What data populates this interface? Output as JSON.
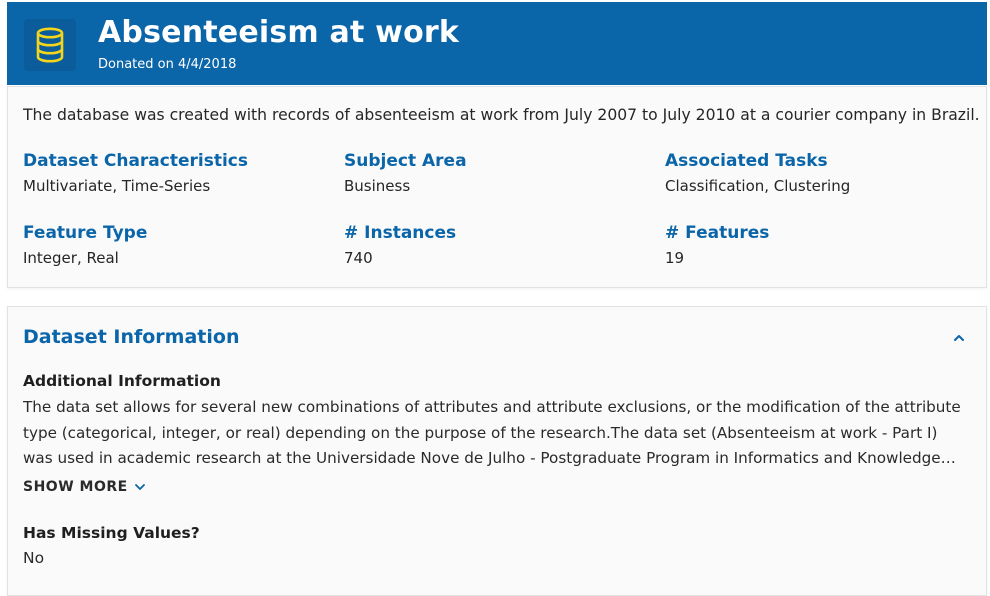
{
  "header": {
    "title": "Absenteeism at work",
    "donated": "Donated on 4/4/2018",
    "icon": "database-icon",
    "background_color": "#0b65a9",
    "icon_color": "#f2d51c"
  },
  "summary": {
    "description": "The database was created with records of absenteeism at work from July 2007 to July 2010 at a courier company in Brazil.",
    "stats": [
      {
        "label": "Dataset Characteristics",
        "value": "Multivariate, Time-Series"
      },
      {
        "label": "Subject Area",
        "value": "Business"
      },
      {
        "label": "Associated Tasks",
        "value": "Classification, Clustering"
      },
      {
        "label": "Feature Type",
        "value": "Integer, Real"
      },
      {
        "label": "# Instances",
        "value": "740"
      },
      {
        "label": "# Features",
        "value": "19"
      }
    ]
  },
  "dataset_information": {
    "title": "Dataset Information",
    "collapse_icon": "chevron-up-icon",
    "additional_heading": "Additional Information",
    "additional_lines": [
      "The data set allows for several new combinations of attributes and attribute exclusions, or the modification of the attribute",
      "type (categorical, integer, or real) depending on the purpose of the research.The data set (Absenteeism at work - Part I)",
      "was used in academic research at the Universidade Nove de Julho - Postgraduate Program in Informatics and Knowledge…"
    ],
    "show_more": "SHOW MORE",
    "show_more_icon": "chevron-down-icon",
    "missing_heading": "Has Missing Values?",
    "missing_value": "No",
    "accent_color": "#0b65a9"
  }
}
